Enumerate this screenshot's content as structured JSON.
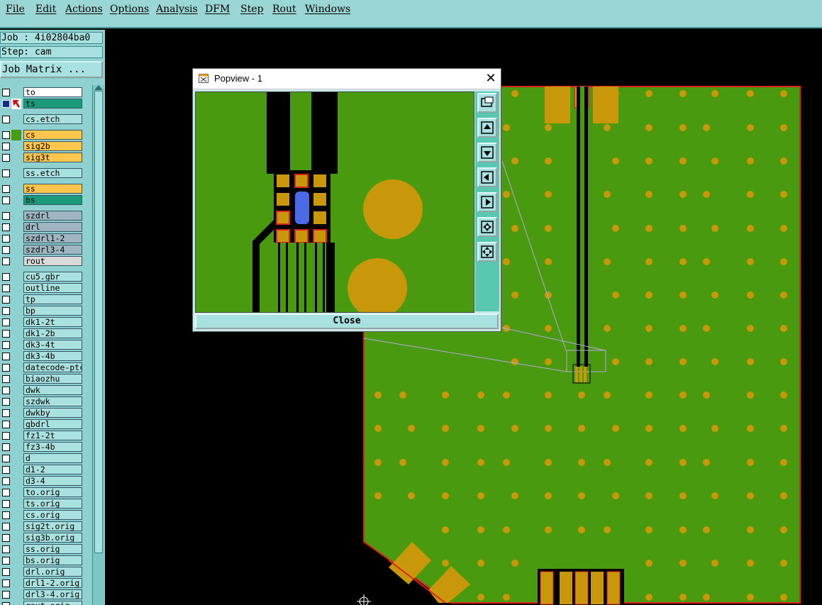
{
  "menubar": {
    "items": [
      "File",
      "Edit",
      "Actions",
      "Options",
      "Analysis",
      "DFM",
      "Step",
      "Rout",
      "Windows"
    ]
  },
  "job": {
    "job_label": "Job : 4i02804ba0",
    "step_label": "Step: cam",
    "matrix_button": "Job Matrix ..."
  },
  "layers": [
    {
      "name": "to",
      "color": "#ffffff"
    },
    {
      "name": "ts",
      "color": "#1a9a7a",
      "active": true
    },
    {
      "name": "cs.etch",
      "color": "#a9e0e0"
    },
    {
      "name": "cs",
      "color": "#ffc64d",
      "swatch": "#4a9a10"
    },
    {
      "name": "sig2b",
      "color": "#ffc64d"
    },
    {
      "name": "sig3t",
      "color": "#ffc64d"
    },
    {
      "name": "ss.etch",
      "color": "#a9e0e0"
    },
    {
      "name": "ss",
      "color": "#ffc64d"
    },
    {
      "name": "bs",
      "color": "#1a9a7a"
    },
    {
      "name": "szdrl",
      "color": "#9fb6c2"
    },
    {
      "name": "drl",
      "color": "#9fb6c2"
    },
    {
      "name": "szdrl1-2",
      "color": "#9fb6c2"
    },
    {
      "name": "szdrl3-4",
      "color": "#9fb6c2"
    },
    {
      "name": "rout",
      "color": "#d9d9d9"
    },
    {
      "name": "cu5.gbr",
      "color": "#a9e0e0"
    },
    {
      "name": "outline",
      "color": "#a9e0e0"
    },
    {
      "name": "tp",
      "color": "#a9e0e0"
    },
    {
      "name": "bp",
      "color": "#a9e0e0"
    },
    {
      "name": "dk1-2t",
      "color": "#a9e0e0"
    },
    {
      "name": "dk1-2b",
      "color": "#a9e0e0"
    },
    {
      "name": "dk3-4t",
      "color": "#a9e0e0"
    },
    {
      "name": "dk3-4b",
      "color": "#a9e0e0"
    },
    {
      "name": "datecode-ptc",
      "color": "#a9e0e0"
    },
    {
      "name": "biaozhu",
      "color": "#a9e0e0"
    },
    {
      "name": "dwk",
      "color": "#a9e0e0"
    },
    {
      "name": "szdwk",
      "color": "#a9e0e0"
    },
    {
      "name": "dwkby",
      "color": "#a9e0e0"
    },
    {
      "name": "gbdrl",
      "color": "#a9e0e0"
    },
    {
      "name": "fz1-2t",
      "color": "#a9e0e0"
    },
    {
      "name": "fz3-4b",
      "color": "#a9e0e0"
    },
    {
      "name": "d",
      "color": "#a9e0e0"
    },
    {
      "name": "d1-2",
      "color": "#a9e0e0"
    },
    {
      "name": "d3-4",
      "color": "#a9e0e0"
    },
    {
      "name": "to.orig",
      "color": "#a9e0e0"
    },
    {
      "name": "ts.orig",
      "color": "#a9e0e0"
    },
    {
      "name": "cs.orig",
      "color": "#a9e0e0"
    },
    {
      "name": "sig2t.orig",
      "color": "#a9e0e0"
    },
    {
      "name": "sig3b.orig",
      "color": "#a9e0e0"
    },
    {
      "name": "ss.orig",
      "color": "#a9e0e0"
    },
    {
      "name": "bs.orig",
      "color": "#a9e0e0"
    },
    {
      "name": "drl.orig",
      "color": "#a9e0e0"
    },
    {
      "name": "drl1-2.orig",
      "color": "#a9e0e0"
    },
    {
      "name": "drl3-4.orig",
      "color": "#a9e0e0"
    },
    {
      "name": "rout.orig",
      "color": "#a9e0e0"
    }
  ],
  "popview": {
    "title": "Popview - 1",
    "close_button": "Close",
    "tools": [
      "zoom-window-icon",
      "move-up-icon",
      "move-down-icon",
      "move-left-icon",
      "move-right-icon",
      "zoom-fit-icon",
      "zoom-home-icon"
    ]
  },
  "colors": {
    "board_green": "#4a9a10",
    "pad_gold": "#c9980a",
    "trace_black": "#000000",
    "outline_red": "#e0201a",
    "highlight_blue": "#4a6ae8",
    "ui_cyan": "#9ad6d6"
  }
}
